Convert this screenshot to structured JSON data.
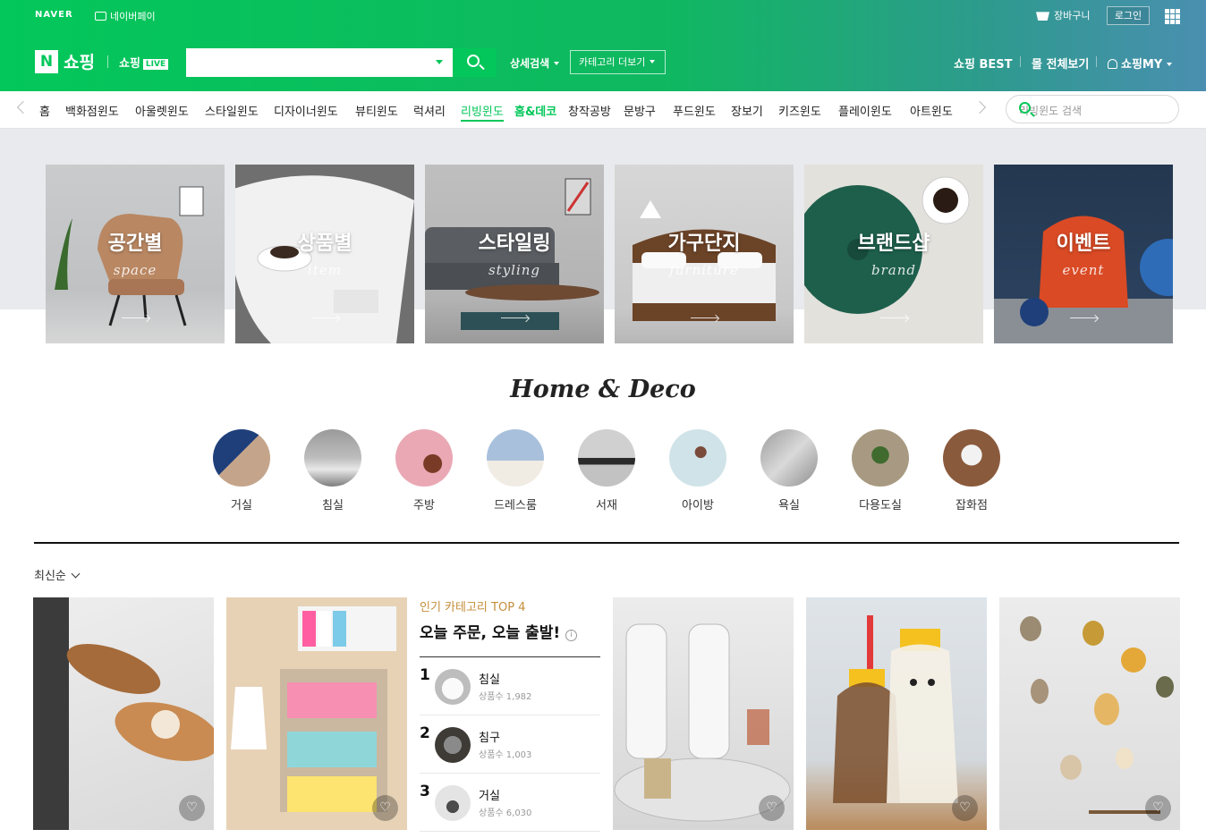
{
  "topbar": {
    "naver": "NAVER",
    "npay": "네이버페이",
    "cart": "장바구니",
    "login": "로그인"
  },
  "header": {
    "logo_n": "N",
    "logo_text": "쇼핑",
    "live_text": "쇼핑",
    "live_badge": "LIVE",
    "search_value": "",
    "detail_search": "상세검색",
    "category_more": "카테고리 더보기",
    "shopping_best": "쇼핑 BEST",
    "mall_all": "몰 전체보기",
    "my": "쇼핑MY"
  },
  "nav": {
    "items": [
      "홈",
      "백화점윈도",
      "아울렛윈도",
      "스타일윈도",
      "디자이너윈도",
      "뷰티윈도",
      "럭셔리",
      "리빙윈도",
      "홈&데코",
      "창작공방",
      "문방구",
      "푸드윈도",
      "장보기",
      "키즈윈도",
      "플레이윈도",
      "아트윈도"
    ],
    "search_placeholder": "리빙윈도 검색"
  },
  "tiles": [
    {
      "ko": "공간별",
      "en": "space"
    },
    {
      "ko": "상품별",
      "en": "item"
    },
    {
      "ko": "스타일링",
      "en": "styling"
    },
    {
      "ko": "가구단지",
      "en": "furniture"
    },
    {
      "ko": "브랜드샵",
      "en": "brand"
    },
    {
      "ko": "이벤트",
      "en": "event"
    }
  ],
  "section": {
    "title": "Home & Deco",
    "sort": "최신순"
  },
  "rooms": [
    "거실",
    "침실",
    "주방",
    "드레스룸",
    "서재",
    "아이방",
    "욕실",
    "다용도실",
    "잡화점"
  ],
  "top4": {
    "subtitle": "인기 카테고리 TOP 4",
    "title": "오늘 주문, 오늘 출발!",
    "info": "i",
    "ranks": [
      {
        "n": "1",
        "name": "침실",
        "count": "상품수 1,982"
      },
      {
        "n": "2",
        "name": "침구",
        "count": "상품수 1,003"
      },
      {
        "n": "3",
        "name": "거실",
        "count": "상품수 6,030"
      }
    ]
  },
  "colors": {
    "brand": "#03c75a",
    "accent": "#c48e3a"
  },
  "icons": {
    "heart": "♡",
    "search": "search-icon"
  }
}
